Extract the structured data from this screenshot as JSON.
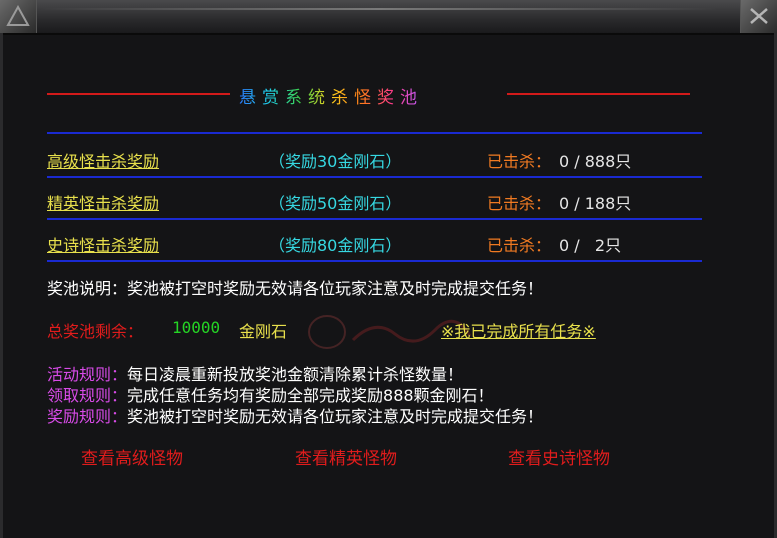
{
  "title": "悬赏系统杀怪奖池",
  "tasks": [
    {
      "name": "高级怪击杀奖励",
      "reward": "（奖励30金刚石）",
      "killed_label": "已击杀：",
      "count": "0 / 888只"
    },
    {
      "name": "精英怪击杀奖励",
      "reward": "（奖励50金刚石）",
      "killed_label": "已击杀：",
      "count": "0 / 188只"
    },
    {
      "name": "史诗怪击杀奖励",
      "reward": "（奖励80金刚石）",
      "killed_label": "已击杀：",
      "count": "0 /   2只"
    }
  ],
  "description": "奖池说明：奖池被打空时奖励无效请各位玩家注意及时完成提交任务！",
  "pool": {
    "label": "总奖池剩余：",
    "remaining": "10000",
    "unit": "金刚石",
    "complete_link": "※我已完成所有任务※"
  },
  "rules": [
    {
      "key": "活动规则：",
      "text": "每日凌晨重新投放奖池金额清除累计杀怪数量！"
    },
    {
      "key": "领取规则：",
      "text": "完成任意任务均有奖励全部完成奖励888颗金刚石！"
    },
    {
      "key": "奖励规则：",
      "text": "奖池被打空时奖励无效请各位玩家注意及时完成提交任务！"
    }
  ],
  "buttons": {
    "view_advanced": "查看高级怪物",
    "view_elite": "查看精英怪物",
    "view_epic": "查看史诗怪物"
  },
  "colors": {
    "background": "#141416",
    "task_name": "#e8e04c",
    "reward": "#36d8e2",
    "killed": "#f07a22",
    "pool_label": "#e01c1c",
    "pool_number": "#25d425",
    "rule_key": "#d84be8",
    "divider": "#1a2ad1",
    "title_rule": "#d21a1a"
  }
}
